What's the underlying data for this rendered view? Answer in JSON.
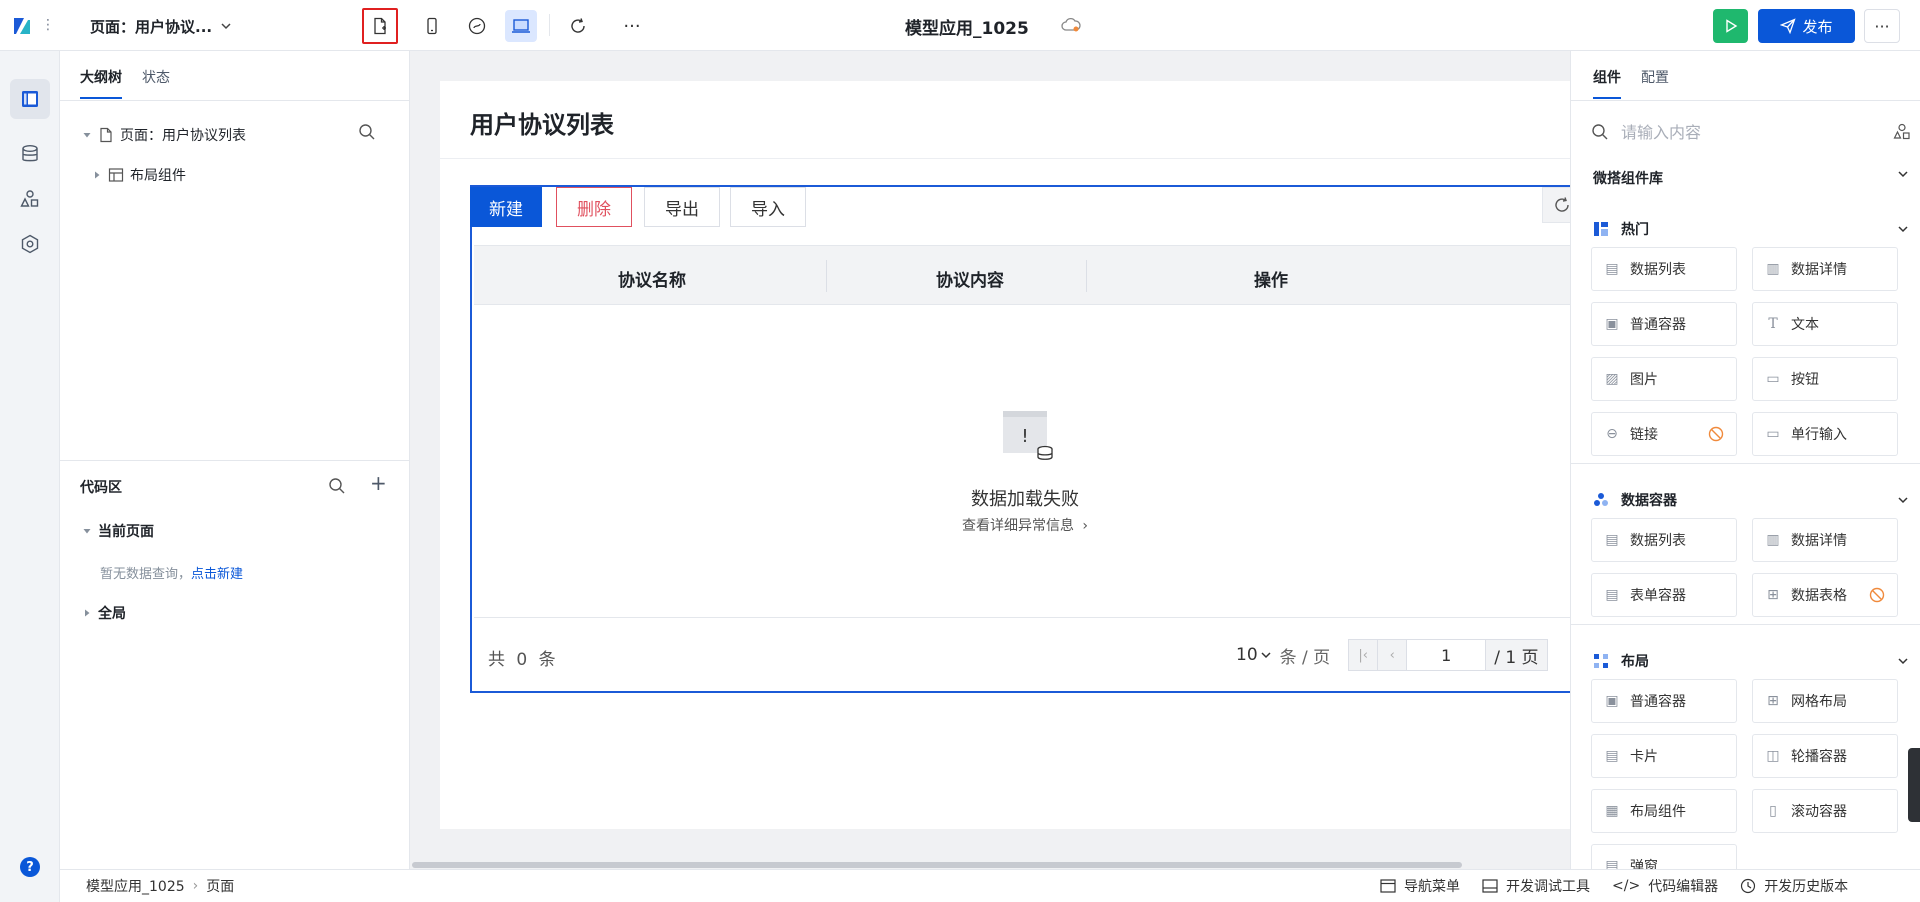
{
  "topbar": {
    "page_selector": "页面：用户协议...",
    "app_title": "模型应用_1025",
    "publish_label": "发布",
    "more_label": "···"
  },
  "outline": {
    "tabs": [
      "大纲树",
      "状态"
    ],
    "tree": [
      {
        "label": "页面：用户协议列表"
      },
      {
        "label": "布局组件"
      }
    ],
    "code_title": "代码区",
    "current_page": "当前页面",
    "empty_hint": "暂无数据查询，",
    "empty_hint_link": "点击新建",
    "global": "全局"
  },
  "canvas": {
    "page_title": "用户协议列表",
    "buttons": {
      "create": "新建",
      "delete": "删除",
      "export": "导出",
      "import": "导入"
    },
    "columns": [
      "协议名称",
      "协议内容",
      "操作"
    ],
    "empty_text": "数据加载失败",
    "empty_link": "查看详细异常信息",
    "total_prefix": "共",
    "total_count": "0",
    "total_suffix": "条",
    "page_size": "10",
    "page_size_unit": "条 / 页",
    "current_page": "1",
    "total_pages": "/ 1 页"
  },
  "right": {
    "tabs": [
      "组件",
      "配置"
    ],
    "search_placeholder": "请输入内容",
    "library": "微搭组件库",
    "sections": [
      {
        "title": "热门",
        "items": [
          "数据列表",
          "数据详情",
          "普通容器",
          "文本",
          "图片",
          "按钮",
          "链接",
          "单行输入"
        ]
      },
      {
        "title": "数据容器",
        "items": [
          "数据列表",
          "数据详情",
          "表单容器",
          "数据表格"
        ]
      },
      {
        "title": "布局",
        "items": [
          "普通容器",
          "网格布局",
          "卡片",
          "轮播容器",
          "布局组件",
          "滚动容器",
          "弹窗"
        ]
      }
    ]
  },
  "statusbar": {
    "crumbs": [
      "模型应用_1025",
      "页面"
    ],
    "nav_menu": "导航菜单",
    "devtools": "开发调试工具",
    "code_editor": "代码编辑器",
    "dev_version": "开发历史版本"
  },
  "colors": {
    "primary": "#0a57d8",
    "run_green": "#1fb86e",
    "danger": "#e0505e",
    "warn_orange": "#f08a3c"
  }
}
